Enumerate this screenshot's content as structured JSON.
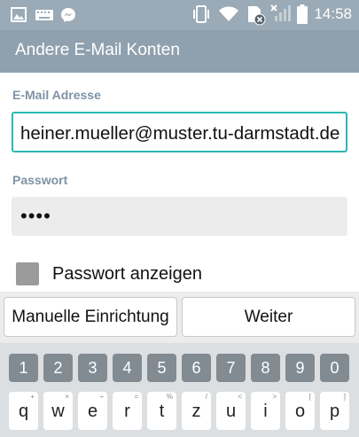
{
  "status_bar": {
    "time": "14:58",
    "icons": [
      "gallery-icon",
      "keyboard-icon",
      "messenger-icon",
      "vibrate-icon",
      "wifi-icon",
      "sim-no-service-icon",
      "signal-icon",
      "battery-icon"
    ]
  },
  "app_bar": {
    "title": "Andere E-Mail Konten"
  },
  "form": {
    "email_label": "E-Mail Adresse",
    "email_value": "heiner.mueller@muster.tu-darmstadt.de",
    "password_label": "Passwort",
    "password_value": "••••",
    "show_password_label": "Passwort anzeigen",
    "show_password_checked": false
  },
  "buttons": {
    "manual_setup": "Manuelle Einrichtung",
    "next": "Weiter"
  },
  "keyboard": {
    "numbers": [
      "1",
      "2",
      "3",
      "4",
      "5",
      "6",
      "7",
      "8",
      "9",
      "0"
    ],
    "row1": [
      {
        "key": "q",
        "hint": "+"
      },
      {
        "key": "w",
        "hint": "×"
      },
      {
        "key": "e",
        "hint": "÷"
      },
      {
        "key": "r",
        "hint": "="
      },
      {
        "key": "t",
        "hint": "%"
      },
      {
        "key": "z",
        "hint": "/"
      },
      {
        "key": "u",
        "hint": "<"
      },
      {
        "key": "i",
        "hint": ">"
      },
      {
        "key": "o",
        "hint": "["
      },
      {
        "key": "p",
        "hint": "]"
      }
    ]
  }
}
